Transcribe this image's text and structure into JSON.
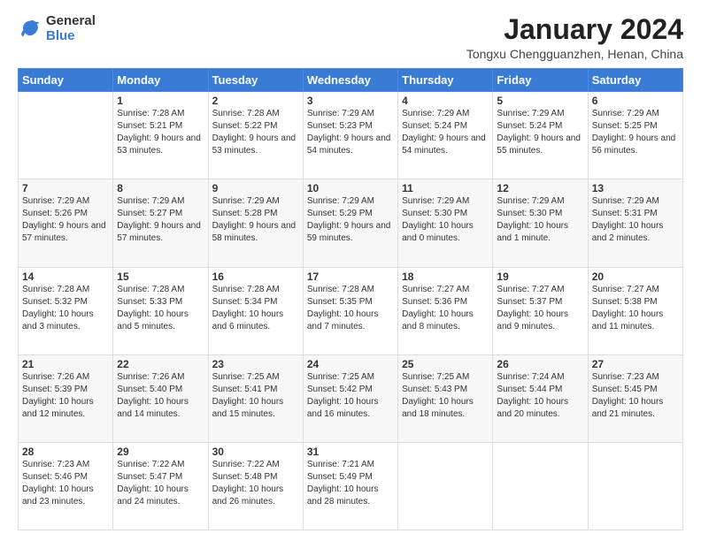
{
  "header": {
    "logo_general": "General",
    "logo_blue": "Blue",
    "month_year": "January 2024",
    "location": "Tongxu Chengguanzhen, Henan, China"
  },
  "days_of_week": [
    "Sunday",
    "Monday",
    "Tuesday",
    "Wednesday",
    "Thursday",
    "Friday",
    "Saturday"
  ],
  "weeks": [
    [
      {
        "day": "",
        "info": ""
      },
      {
        "day": "1",
        "info": "Sunrise: 7:28 AM\nSunset: 5:21 PM\nDaylight: 9 hours\nand 53 minutes."
      },
      {
        "day": "2",
        "info": "Sunrise: 7:28 AM\nSunset: 5:22 PM\nDaylight: 9 hours\nand 53 minutes."
      },
      {
        "day": "3",
        "info": "Sunrise: 7:29 AM\nSunset: 5:23 PM\nDaylight: 9 hours\nand 54 minutes."
      },
      {
        "day": "4",
        "info": "Sunrise: 7:29 AM\nSunset: 5:24 PM\nDaylight: 9 hours\nand 54 minutes."
      },
      {
        "day": "5",
        "info": "Sunrise: 7:29 AM\nSunset: 5:24 PM\nDaylight: 9 hours\nand 55 minutes."
      },
      {
        "day": "6",
        "info": "Sunrise: 7:29 AM\nSunset: 5:25 PM\nDaylight: 9 hours\nand 56 minutes."
      }
    ],
    [
      {
        "day": "7",
        "info": "Sunrise: 7:29 AM\nSunset: 5:26 PM\nDaylight: 9 hours\nand 57 minutes."
      },
      {
        "day": "8",
        "info": "Sunrise: 7:29 AM\nSunset: 5:27 PM\nDaylight: 9 hours\nand 57 minutes."
      },
      {
        "day": "9",
        "info": "Sunrise: 7:29 AM\nSunset: 5:28 PM\nDaylight: 9 hours\nand 58 minutes."
      },
      {
        "day": "10",
        "info": "Sunrise: 7:29 AM\nSunset: 5:29 PM\nDaylight: 9 hours\nand 59 minutes."
      },
      {
        "day": "11",
        "info": "Sunrise: 7:29 AM\nSunset: 5:30 PM\nDaylight: 10 hours\nand 0 minutes."
      },
      {
        "day": "12",
        "info": "Sunrise: 7:29 AM\nSunset: 5:30 PM\nDaylight: 10 hours\nand 1 minute."
      },
      {
        "day": "13",
        "info": "Sunrise: 7:29 AM\nSunset: 5:31 PM\nDaylight: 10 hours\nand 2 minutes."
      }
    ],
    [
      {
        "day": "14",
        "info": "Sunrise: 7:28 AM\nSunset: 5:32 PM\nDaylight: 10 hours\nand 3 minutes."
      },
      {
        "day": "15",
        "info": "Sunrise: 7:28 AM\nSunset: 5:33 PM\nDaylight: 10 hours\nand 5 minutes."
      },
      {
        "day": "16",
        "info": "Sunrise: 7:28 AM\nSunset: 5:34 PM\nDaylight: 10 hours\nand 6 minutes."
      },
      {
        "day": "17",
        "info": "Sunrise: 7:28 AM\nSunset: 5:35 PM\nDaylight: 10 hours\nand 7 minutes."
      },
      {
        "day": "18",
        "info": "Sunrise: 7:27 AM\nSunset: 5:36 PM\nDaylight: 10 hours\nand 8 minutes."
      },
      {
        "day": "19",
        "info": "Sunrise: 7:27 AM\nSunset: 5:37 PM\nDaylight: 10 hours\nand 9 minutes."
      },
      {
        "day": "20",
        "info": "Sunrise: 7:27 AM\nSunset: 5:38 PM\nDaylight: 10 hours\nand 11 minutes."
      }
    ],
    [
      {
        "day": "21",
        "info": "Sunrise: 7:26 AM\nSunset: 5:39 PM\nDaylight: 10 hours\nand 12 minutes."
      },
      {
        "day": "22",
        "info": "Sunrise: 7:26 AM\nSunset: 5:40 PM\nDaylight: 10 hours\nand 14 minutes."
      },
      {
        "day": "23",
        "info": "Sunrise: 7:25 AM\nSunset: 5:41 PM\nDaylight: 10 hours\nand 15 minutes."
      },
      {
        "day": "24",
        "info": "Sunrise: 7:25 AM\nSunset: 5:42 PM\nDaylight: 10 hours\nand 16 minutes."
      },
      {
        "day": "25",
        "info": "Sunrise: 7:25 AM\nSunset: 5:43 PM\nDaylight: 10 hours\nand 18 minutes."
      },
      {
        "day": "26",
        "info": "Sunrise: 7:24 AM\nSunset: 5:44 PM\nDaylight: 10 hours\nand 20 minutes."
      },
      {
        "day": "27",
        "info": "Sunrise: 7:23 AM\nSunset: 5:45 PM\nDaylight: 10 hours\nand 21 minutes."
      }
    ],
    [
      {
        "day": "28",
        "info": "Sunrise: 7:23 AM\nSunset: 5:46 PM\nDaylight: 10 hours\nand 23 minutes."
      },
      {
        "day": "29",
        "info": "Sunrise: 7:22 AM\nSunset: 5:47 PM\nDaylight: 10 hours\nand 24 minutes."
      },
      {
        "day": "30",
        "info": "Sunrise: 7:22 AM\nSunset: 5:48 PM\nDaylight: 10 hours\nand 26 minutes."
      },
      {
        "day": "31",
        "info": "Sunrise: 7:21 AM\nSunset: 5:49 PM\nDaylight: 10 hours\nand 28 minutes."
      },
      {
        "day": "",
        "info": ""
      },
      {
        "day": "",
        "info": ""
      },
      {
        "day": "",
        "info": ""
      }
    ]
  ]
}
